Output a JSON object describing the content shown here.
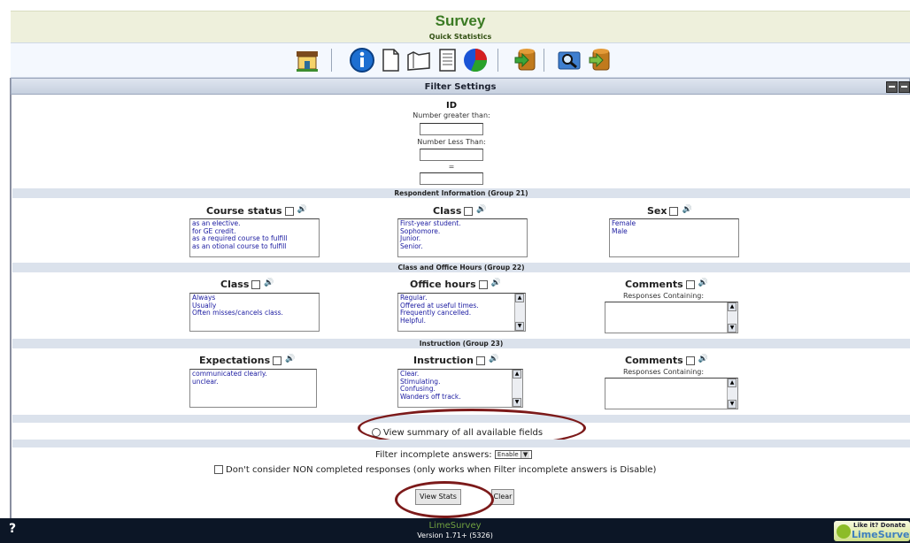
{
  "header": {
    "title": "Survey",
    "subtitle": "Quick Statistics"
  },
  "toolbar_icons": [
    "home-icon",
    "info-icon",
    "document-icon",
    "folder-icon",
    "report-icon",
    "pie-chart-icon",
    "export-database-icon",
    "search-icon",
    "import-database-icon"
  ],
  "filter": {
    "title": "Filter Settings",
    "id_label": "ID",
    "greater_label": "Number greater than:",
    "less_label": "Number Less Than:",
    "equals_label": "=",
    "greater_value": "",
    "less_value": "",
    "equals_value": ""
  },
  "groups": [
    {
      "title": "Respondent Information (Group 21)",
      "questions": [
        {
          "label": "Course status",
          "type": "list",
          "options": [
            "as an elective.",
            "for GE credit.",
            "as a required course to fulfill",
            "as an otional course to fulfill"
          ]
        },
        {
          "label": "Class",
          "type": "list",
          "options": [
            "First-year student.",
            "Sophomore.",
            "Junior.",
            "Senior."
          ]
        },
        {
          "label": "Sex",
          "type": "list",
          "options": [
            "Female",
            "Male"
          ]
        }
      ]
    },
    {
      "title": "Class and Office Hours (Group 22)",
      "questions": [
        {
          "label": "Class",
          "type": "list",
          "options": [
            "Always",
            "Usually",
            "Often misses/cancels class."
          ]
        },
        {
          "label": "Office hours",
          "type": "list",
          "options": [
            "Regular.",
            "Offered at useful times.",
            "Frequently cancelled.",
            "Helpful."
          ]
        },
        {
          "label": "Comments",
          "type": "text",
          "sublabel": "Responses Containing:"
        }
      ]
    },
    {
      "title": "Instruction (Group 23)",
      "questions": [
        {
          "label": "Expectations",
          "type": "list",
          "options": [
            "communicated clearly.",
            "unclear."
          ]
        },
        {
          "label": "Instruction",
          "type": "list",
          "options": [
            "Clear.",
            "Stimulating.",
            "Confusing.",
            "Wanders off track."
          ]
        },
        {
          "label": "Comments",
          "type": "text",
          "sublabel": "Responses Containing:"
        }
      ]
    }
  ],
  "summary": {
    "label": "View summary of all available fields"
  },
  "incomplete": {
    "label": "Filter incomplete answers:",
    "selected": "Enable",
    "noncomplete_label": "Don't consider NON completed responses (only works when Filter incomplete answers is Disable)"
  },
  "buttons": {
    "view_stats": "View Stats",
    "clear": "Clear"
  },
  "footer": {
    "help": "?",
    "app_name": "LimeSurvey",
    "version": "Version 1.71+ (5326)",
    "donate_line1": "Like it? Donate",
    "donate_line2": "LimeSurvey"
  },
  "colors": {
    "header_text": "#3a7a23",
    "footer_bg": "#0c1626",
    "annotation": "#7c1a1a",
    "list_text": "#1a1aa0"
  }
}
